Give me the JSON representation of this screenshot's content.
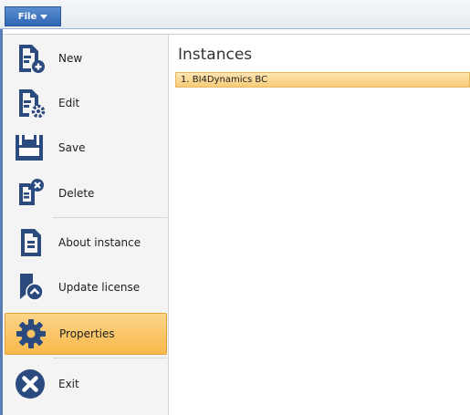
{
  "toolbar": {
    "file_label": "File"
  },
  "menu": {
    "items": [
      {
        "label": "New",
        "icon": "document-new-icon"
      },
      {
        "label": "Edit",
        "icon": "document-edit-icon"
      },
      {
        "label": "Save",
        "icon": "save-icon"
      },
      {
        "label": "Delete",
        "icon": "document-delete-icon"
      },
      {
        "label": "About instance",
        "icon": "document-info-icon"
      },
      {
        "label": "Update license",
        "icon": "license-icon"
      },
      {
        "label": "Properties",
        "icon": "gear-icon",
        "selected": true
      },
      {
        "label": "Exit",
        "icon": "exit-icon"
      }
    ]
  },
  "content": {
    "title": "Instances",
    "instances": [
      "1. BI4Dynamics BC"
    ]
  },
  "colors": {
    "accent_blue": "#2f66b3",
    "icon_navy": "#2b4a7e",
    "selected_orange": "#f7b84a"
  }
}
